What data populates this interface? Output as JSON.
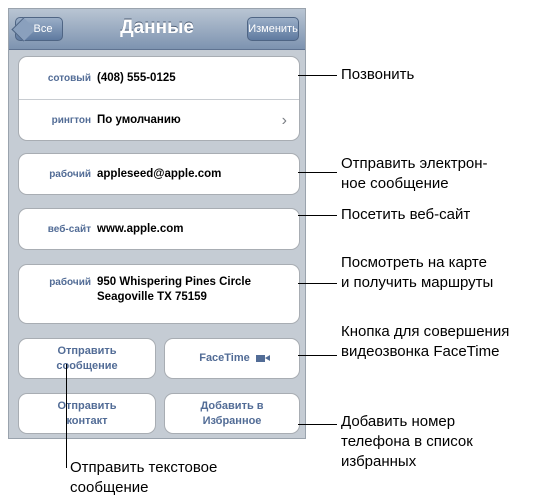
{
  "navbar": {
    "back_label": "Все",
    "title": "Данные",
    "edit_label": "Изменить"
  },
  "phone_group": {
    "rows": [
      {
        "label": "сотовый",
        "value": "(408) 555-0125"
      },
      {
        "label": "рингтон",
        "value": "По умолчанию"
      }
    ]
  },
  "email": {
    "label": "рабочий",
    "value": "appleseed@apple.com"
  },
  "website": {
    "label": "веб-сайт",
    "value": "www.apple.com"
  },
  "address": {
    "label": "рабочий",
    "line1": "950 Whispering Pines Circle",
    "line2": "Seagoville TX 75159"
  },
  "buttons": {
    "send_message": "Отправить сообщение",
    "facetime": "FaceTime",
    "share_contact": "Отправить контакт",
    "add_favorites": "Добавить в Избранное"
  },
  "callouts": {
    "call": "Позвонить",
    "email": "Отправить электрон-\nное сообщение",
    "website": "Посетить веб-сайт",
    "map": "Посмотреть на карте\nи получить маршруты",
    "facetime": "Кнопка для совершения\nвидеозвонка FaceTime",
    "favorites": "Добавить номер\nтелефона в список\nизбранных",
    "text_message": "Отправить текстовое\nсообщение"
  },
  "icons": {
    "ringtone_chevron": "chevron-right-icon",
    "facetime_camera": "video-camera-icon"
  }
}
